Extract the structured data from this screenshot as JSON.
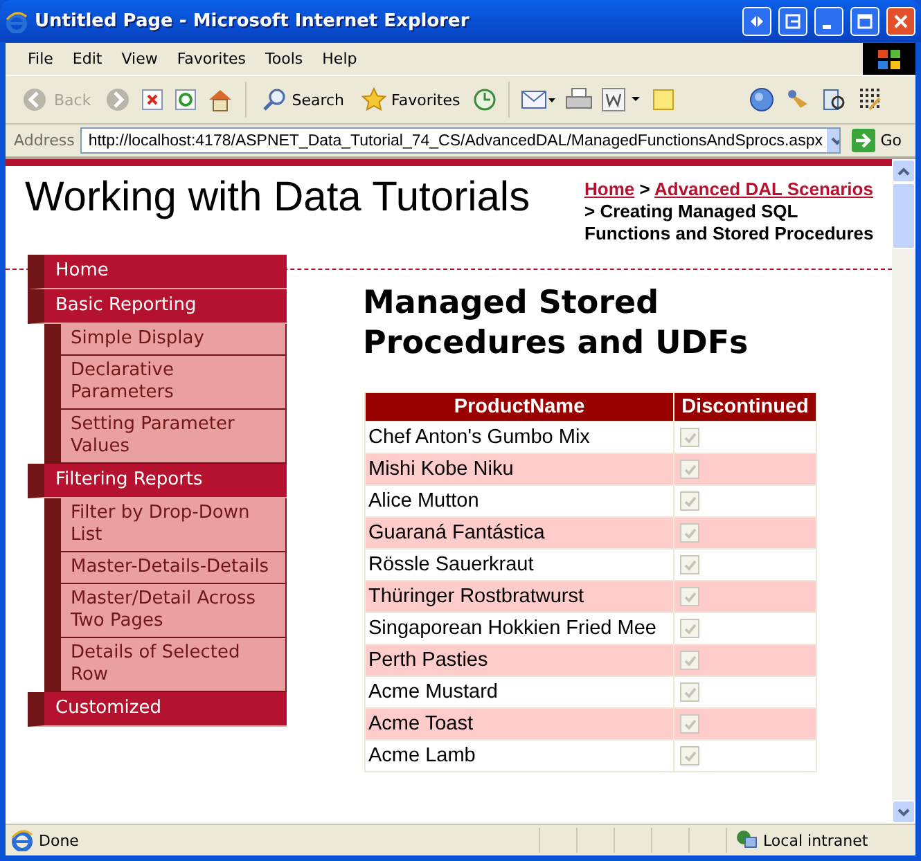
{
  "window": {
    "title": "Untitled Page - Microsoft Internet Explorer"
  },
  "menu": [
    "File",
    "Edit",
    "View",
    "Favorites",
    "Tools",
    "Help"
  ],
  "toolbar": [
    {
      "label": "Back",
      "disabled": true
    },
    {
      "label": "Search",
      "disabled": false
    },
    {
      "label": "Favorites",
      "disabled": false
    }
  ],
  "address": {
    "label": "Address",
    "value": "http://localhost:4178/ASPNET_Data_Tutorial_74_CS/AdvancedDAL/ManagedFunctionsAndSprocs.aspx",
    "go": "Go"
  },
  "page": {
    "site_title": "Working with Data Tutorials",
    "breadcrumb": {
      "links": [
        "Home",
        "Advanced DAL Scenarios"
      ],
      "separator": ">",
      "current": "Creating Managed SQL Functions and Stored Procedures"
    },
    "nav": [
      {
        "label": "Home"
      },
      {
        "label": "Basic Reporting",
        "children": [
          {
            "label": "Simple Display"
          },
          {
            "label": "Declarative Parameters"
          },
          {
            "label": "Setting Parameter Values"
          }
        ]
      },
      {
        "label": "Filtering Reports",
        "children": [
          {
            "label": "Filter by Drop-Down List"
          },
          {
            "label": "Master-Details-Details"
          },
          {
            "label": "Master/Detail Across Two Pages"
          },
          {
            "label": "Details of Selected Row"
          }
        ]
      },
      {
        "label": "Customized"
      }
    ],
    "heading": "Managed Stored Procedures and UDFs",
    "table": {
      "columns": [
        "ProductName",
        "Discontinued"
      ],
      "rows": [
        {
          "name": "Chef Anton's Gumbo Mix",
          "discontinued": true,
          "disabled": true
        },
        {
          "name": "Mishi Kobe Niku",
          "discontinued": true,
          "disabled": true
        },
        {
          "name": "Alice Mutton",
          "discontinued": true,
          "disabled": true
        },
        {
          "name": "Guaraná Fantástica",
          "discontinued": true,
          "disabled": true
        },
        {
          "name": "Rössle Sauerkraut",
          "discontinued": true,
          "disabled": true
        },
        {
          "name": "Thüringer Rostbratwurst",
          "discontinued": true,
          "disabled": true
        },
        {
          "name": "Singaporean Hokkien Fried Mee",
          "discontinued": true,
          "disabled": true
        },
        {
          "name": "Perth Pasties",
          "discontinued": true,
          "disabled": true
        },
        {
          "name": "Acme Mustard",
          "discontinued": true,
          "disabled": true
        },
        {
          "name": "Acme Toast",
          "discontinued": true,
          "disabled": true
        },
        {
          "name": "Acme Lamb",
          "discontinued": true,
          "disabled": true
        }
      ]
    }
  },
  "status_bar": {
    "text": "Done",
    "zone": "Local intranet"
  }
}
